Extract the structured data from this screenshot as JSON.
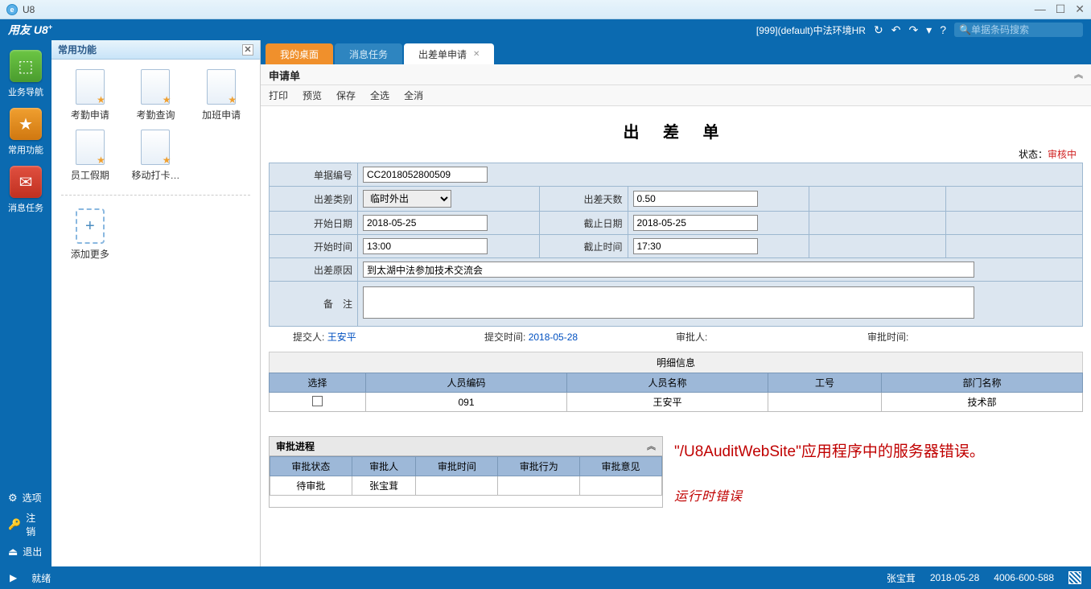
{
  "window": {
    "title": "U8"
  },
  "header": {
    "brand": "用友 U8",
    "orginfo": "[999](default)中法环境HR",
    "search_placeholder": "单据条码搜索"
  },
  "leftrail": {
    "nav": "业务导航",
    "fav": "常用功能",
    "msg": "消息任务",
    "options": "选项",
    "logout": "注销",
    "exit": "退出"
  },
  "sidepanel": {
    "title": "常用功能",
    "items": [
      "考勤申请",
      "考勤查询",
      "加班申请",
      "员工假期",
      "移动打卡…"
    ],
    "addmore": "添加更多"
  },
  "tabs": {
    "desktop": "我的桌面",
    "messages": "消息任务",
    "trip": "出差单申请"
  },
  "doc": {
    "title": "申请单",
    "actions": {
      "print": "打印",
      "preview": "预览",
      "save": "保存",
      "selectall": "全选",
      "deselectall": "全消"
    }
  },
  "form": {
    "title": "出 差 单",
    "status_label": "状态：",
    "status_value": "审核中",
    "labels": {
      "docno": "单据编号",
      "triptype": "出差类别",
      "tripdays": "出差天数",
      "startdate": "开始日期",
      "enddate": "截止日期",
      "starttime": "开始时间",
      "endtime": "截止时间",
      "reason": "出差原因",
      "remark": "备　注"
    },
    "values": {
      "docno": "CC2018052800509",
      "triptype": "临时外出",
      "tripdays": "0.50",
      "startdate": "2018-05-25",
      "enddate": "2018-05-25",
      "starttime": "13:00",
      "endtime": "17:30",
      "reason": "到太湖中法参加技术交流会",
      "remark": ""
    },
    "submit": {
      "submitter_l": "提交人:",
      "submitter_v": "王安平",
      "submittime_l": "提交时间:",
      "submittime_v": "2018-05-28",
      "approver_l": "审批人:",
      "approver_v": "",
      "approvetime_l": "审批时间:",
      "approvetime_v": ""
    }
  },
  "detail": {
    "title": "明细信息",
    "headers": {
      "sel": "选择",
      "code": "人员编码",
      "name": "人员名称",
      "empno": "工号",
      "dept": "部门名称"
    },
    "row": {
      "code": "091",
      "name": "王安平",
      "empno": "",
      "dept": "技术部"
    }
  },
  "approval": {
    "title": "审批进程",
    "headers": {
      "status": "审批状态",
      "person": "审批人",
      "time": "审批时间",
      "action": "审批行为",
      "comment": "审批意见"
    },
    "row": {
      "status": "待审批",
      "person": "张宝茸",
      "time": "",
      "action": "",
      "comment": ""
    }
  },
  "error": {
    "line1": "\"/U8AuditWebSite\"应用程序中的服务器错误。",
    "line2": "运行时错误"
  },
  "statusbar": {
    "ready": "就绪",
    "user": "张宝茸",
    "date": "2018-05-28",
    "phone": "4006-600-588"
  }
}
